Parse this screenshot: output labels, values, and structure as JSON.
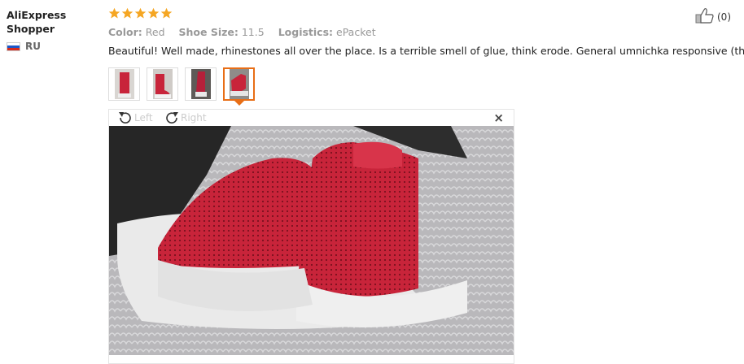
{
  "reviewer": {
    "name": "AliExpress Shopper",
    "country": "RU"
  },
  "rating": 5,
  "attributes": [
    {
      "label": "Color:",
      "value": "Red"
    },
    {
      "label": "Shoe Size:",
      "value": "11.5"
    },
    {
      "label": "Logistics:",
      "value": "ePacket"
    }
  ],
  "review_text": "Beautiful! Well made, rhinestones all over the place. Is a terrible smell of glue, think erode. General umnichka responsive (th).",
  "helpful": {
    "count": "(0)",
    "icon": "thumbs-up-icon"
  },
  "viewer": {
    "rotate_left": "Left",
    "rotate_right": "Right",
    "close": "×"
  },
  "colors": {
    "star": "#f5a623",
    "accent": "#e86e16",
    "shoe": "#c8243a"
  }
}
